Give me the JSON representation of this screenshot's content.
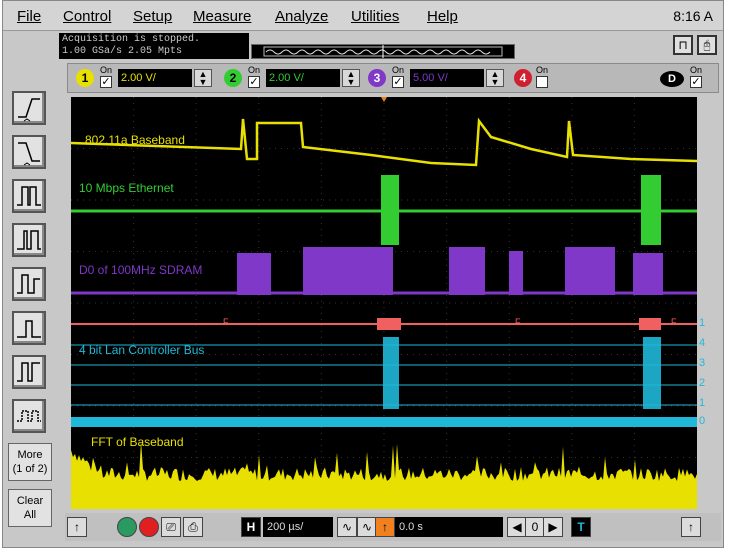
{
  "menu": [
    "File",
    "Control",
    "Setup",
    "Measure",
    "Analyze",
    "Utilities",
    "Help"
  ],
  "clock": "8:16 A",
  "status": {
    "line1": "Acquisition is stopped.",
    "line2": "1.00 GSa/s  2.05 Mpts"
  },
  "channels": [
    {
      "num": "1",
      "on": "On",
      "scale": "2.00 V/",
      "color": "#e8e000",
      "checked": true
    },
    {
      "num": "2",
      "on": "On",
      "scale": "2.00 V/",
      "color": "#33cc33",
      "checked": true
    },
    {
      "num": "3",
      "on": "On",
      "scale": "5.00 V/",
      "color": "#7f38c8",
      "checked": true
    },
    {
      "num": "4",
      "on": "On",
      "scale": "",
      "color": "#d02030",
      "checked": false
    }
  ],
  "digital": {
    "label": "D",
    "on": "On"
  },
  "traces": {
    "t1": "802.11a Baseband",
    "t2": "10 Mbps Ethernet",
    "t3": "D0 of 100MHz SDRAM",
    "t4": "4 bit Lan Controller Bus",
    "t5": "FFT of Baseband"
  },
  "bus": {
    "f1": "F",
    "f2": "F",
    "f3": "F",
    "bits": [
      "1",
      "4",
      "3",
      "2",
      "1",
      "0"
    ]
  },
  "left_buttons": {
    "more": "More\n(1 of 2)",
    "more_a": "More",
    "more_b": "(1 of 2)",
    "clear_a": "Clear",
    "clear_b": "All"
  },
  "bottom": {
    "timebase": "200 µs/",
    "delay": "0.0 s",
    "h_label": "H",
    "t_label": "T"
  },
  "colors": {
    "ch1": "#e8e000",
    "ch2": "#33cc33",
    "ch3": "#7f38c8",
    "bus": "#20b8d8",
    "marker": "#f06060"
  }
}
